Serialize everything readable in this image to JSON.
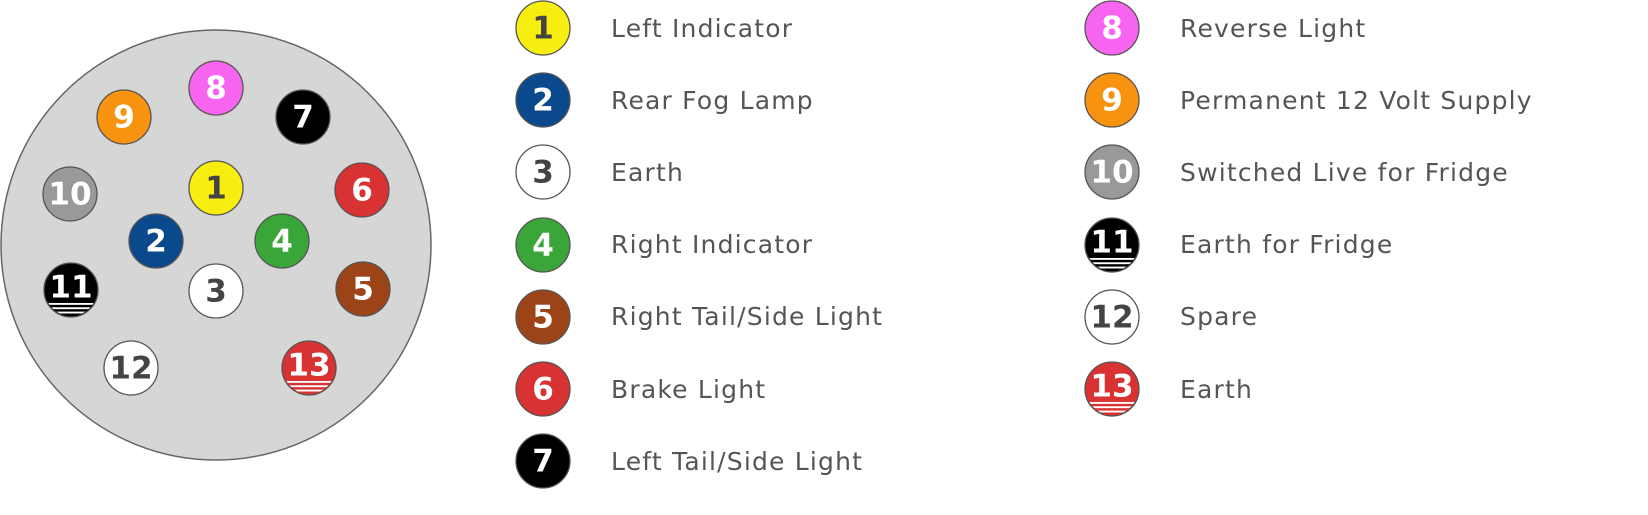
{
  "pins": [
    {
      "number": "1",
      "label": "Left Indicator",
      "color": "#f7ee10",
      "text_color": "#444444",
      "stripes": null
    },
    {
      "number": "2",
      "label": "Rear Fog Lamp",
      "color": "#0a4a8c",
      "text_color": "#ffffff",
      "stripes": null
    },
    {
      "number": "3",
      "label": "Earth",
      "color": "#ffffff",
      "text_color": "#444444",
      "stripes": null
    },
    {
      "number": "4",
      "label": "Right Indicator",
      "color": "#3aa63a",
      "text_color": "#ffffff",
      "stripes": null
    },
    {
      "number": "5",
      "label": "Right Tail/Side Light",
      "color": "#9c4418",
      "text_color": "#ffffff",
      "stripes": null
    },
    {
      "number": "6",
      "label": "Brake Light",
      "color": "#d83232",
      "text_color": "#ffffff",
      "stripes": null
    },
    {
      "number": "7",
      "label": "Left Tail/Side Light",
      "color": "#000000",
      "text_color": "#ffffff",
      "stripes": null
    },
    {
      "number": "8",
      "label": "Reverse Light",
      "color": "#f765f0",
      "text_color": "#ffffff",
      "stripes": null
    },
    {
      "number": "9",
      "label": "Permanent 12 Volt Supply",
      "color": "#f7930e",
      "text_color": "#ffffff",
      "stripes": null
    },
    {
      "number": "10",
      "label": "Switched Live for Fridge",
      "color": "#999999",
      "text_color": "#ffffff",
      "stripes": null
    },
    {
      "number": "11",
      "label": "Earth for Fridge",
      "color": "#000000",
      "text_color": "#ffffff",
      "stripes": "#ffffff"
    },
    {
      "number": "12",
      "label": "Spare",
      "color": "#ffffff",
      "text_color": "#444444",
      "stripes": null
    },
    {
      "number": "13",
      "label": "Earth",
      "color": "#d83232",
      "text_color": "#ffffff",
      "stripes": "#ffffff"
    }
  ],
  "plug_color": "#d6d6d6"
}
